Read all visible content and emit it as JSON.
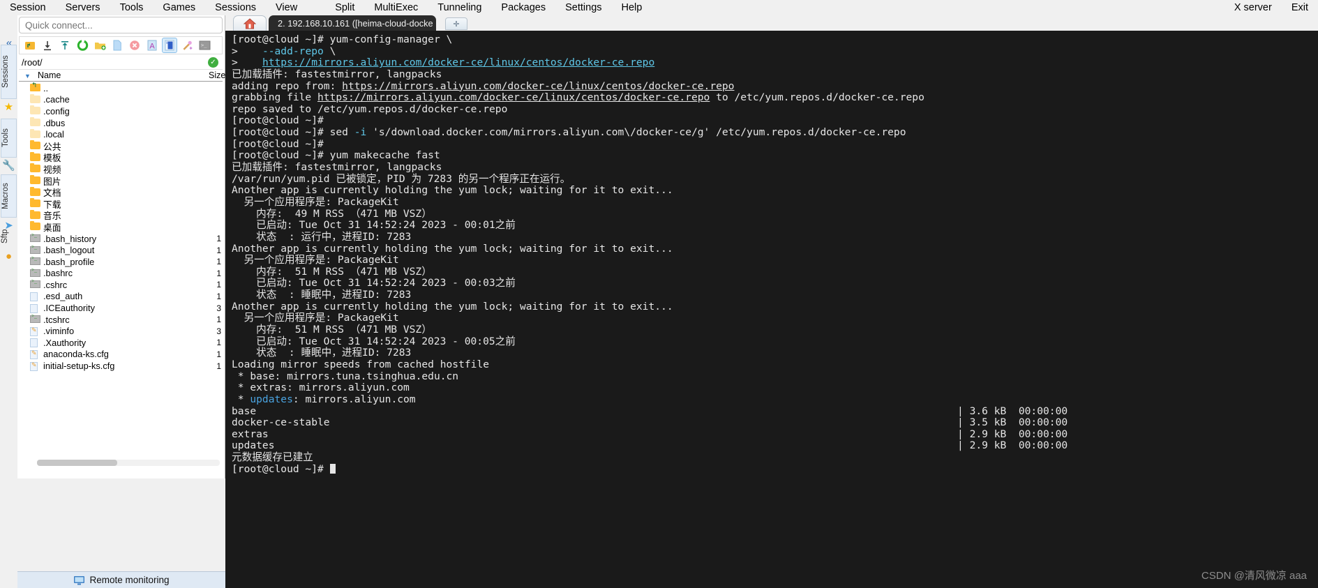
{
  "menubar": {
    "left_items": [
      "Session",
      "Servers",
      "Tools",
      "Games",
      "Sessions",
      "View"
    ],
    "right_group": [
      "Split",
      "MultiExec",
      "Tunneling",
      "Packages",
      "Settings",
      "Help"
    ],
    "far_right": [
      "X server",
      "Exit"
    ]
  },
  "sftp": {
    "quick_connect_placeholder": "Quick connect...",
    "toolbar_icons": [
      "upload-parent-icon",
      "download-icon",
      "upload-icon",
      "refresh-icon",
      "new-folder-icon",
      "new-file-icon",
      "delete-icon",
      "text-mode-icon",
      "follow-terminal-folder-icon",
      "permissions-icon",
      "open-terminal-icon"
    ],
    "path": "/root/",
    "path_status": "ok",
    "columns": {
      "name": "Name",
      "size": "Size"
    },
    "files": [
      {
        "name": "..",
        "size": "",
        "icon": "up"
      },
      {
        "name": ".cache",
        "size": "",
        "icon": "folder-lt"
      },
      {
        "name": ".config",
        "size": "",
        "icon": "folder-lt"
      },
      {
        "name": ".dbus",
        "size": "",
        "icon": "folder-lt"
      },
      {
        "name": ".local",
        "size": "",
        "icon": "folder-lt"
      },
      {
        "name": "公共",
        "size": "",
        "icon": "folder"
      },
      {
        "name": "模板",
        "size": "",
        "icon": "folder"
      },
      {
        "name": "视频",
        "size": "",
        "icon": "folder"
      },
      {
        "name": "图片",
        "size": "",
        "icon": "folder"
      },
      {
        "name": "文档",
        "size": "",
        "icon": "folder"
      },
      {
        "name": "下载",
        "size": "",
        "icon": "folder"
      },
      {
        "name": "音乐",
        "size": "",
        "icon": "folder"
      },
      {
        "name": "桌面",
        "size": "",
        "icon": "folder"
      },
      {
        "name": ".bash_history",
        "size": "1",
        "icon": "script"
      },
      {
        "name": ".bash_logout",
        "size": "1",
        "icon": "script"
      },
      {
        "name": ".bash_profile",
        "size": "1",
        "icon": "script"
      },
      {
        "name": ".bashrc",
        "size": "1",
        "icon": "script"
      },
      {
        "name": ".cshrc",
        "size": "1",
        "icon": "script"
      },
      {
        "name": ".esd_auth",
        "size": "1",
        "icon": "file"
      },
      {
        "name": ".ICEauthority",
        "size": "3",
        "icon": "file"
      },
      {
        "name": ".tcshrc",
        "size": "1",
        "icon": "script"
      },
      {
        "name": ".viminfo",
        "size": "3",
        "icon": "cfg"
      },
      {
        "name": ".Xauthority",
        "size": "1",
        "icon": "file"
      },
      {
        "name": "anaconda-ks.cfg",
        "size": "1",
        "icon": "cfg"
      },
      {
        "name": "initial-setup-ks.cfg",
        "size": "1",
        "icon": "cfg"
      }
    ],
    "status_bar": "Remote monitoring"
  },
  "rail": {
    "collapse_icon": "«",
    "tabs": [
      {
        "label": "Sessions",
        "icon": "star-icon"
      },
      {
        "label": "Tools",
        "icon": "wrench-icon"
      },
      {
        "label": "Macros",
        "icon": "paperplane-icon"
      },
      {
        "label": "Sftp",
        "icon": "dot-icon"
      }
    ]
  },
  "tabs": {
    "home_icon": "home-icon",
    "session_icon": "ssh-icon",
    "session_label": "2. 192.168.10.161 ([heima-cloud-docke",
    "close_label": "✕",
    "new_tab_label": "✛"
  },
  "terminal": {
    "lines": [
      {
        "segs": [
          {
            "t": "[root@cloud ~]# yum-config-manager \\"
          }
        ]
      },
      {
        "segs": [
          {
            "t": ">    "
          },
          {
            "t": "--add-repo",
            "c": "cy"
          },
          {
            "t": " \\"
          }
        ]
      },
      {
        "segs": [
          {
            "t": ">    "
          },
          {
            "t": "https://mirrors.aliyun.com/docker-ce/linux/centos/docker-ce.repo",
            "c": "cy-u"
          }
        ]
      },
      {
        "segs": [
          {
            "t": "已加载插件: fastestmirror, langpacks"
          }
        ]
      },
      {
        "segs": [
          {
            "t": "adding repo from: "
          },
          {
            "t": "https://mirrors.aliyun.com/docker-ce/linux/centos/docker-ce.repo",
            "c": "wh-u"
          }
        ]
      },
      {
        "segs": [
          {
            "t": "grabbing file "
          },
          {
            "t": "https://mirrors.aliyun.com/docker-ce/linux/centos/docker-ce.repo",
            "c": "wh-u"
          },
          {
            "t": " to /etc/yum.repos.d/docker-ce.repo"
          }
        ]
      },
      {
        "segs": [
          {
            "t": "repo saved to /etc/yum.repos.d/docker-ce.repo"
          }
        ]
      },
      {
        "segs": [
          {
            "t": "[root@cloud ~]#"
          }
        ]
      },
      {
        "segs": [
          {
            "t": "[root@cloud ~]# sed "
          },
          {
            "t": "-i",
            "c": "cy"
          },
          {
            "t": " 's/download.docker.com/mirrors.aliyun.com\\/docker-ce/g' /etc/yum.repos.d/docker-ce.repo"
          }
        ]
      },
      {
        "segs": [
          {
            "t": "[root@cloud ~]#"
          }
        ]
      },
      {
        "segs": [
          {
            "t": "[root@cloud ~]# yum makecache fast"
          }
        ]
      },
      {
        "segs": [
          {
            "t": "已加载插件: fastestmirror, langpacks"
          }
        ]
      },
      {
        "segs": [
          {
            "t": "/var/run/yum.pid 已被锁定，PID 为 7283 的另一个程序正在运行。"
          }
        ]
      },
      {
        "segs": [
          {
            "t": "Another app is currently holding the yum lock; waiting for it to exit..."
          }
        ]
      },
      {
        "segs": [
          {
            "t": "  另一个应用程序是: PackageKit"
          }
        ]
      },
      {
        "segs": [
          {
            "t": "    内存:  49 M RSS （471 MB VSZ）"
          }
        ]
      },
      {
        "segs": [
          {
            "t": "    已启动: Tue Oct 31 14:52:24 2023 - 00:01之前"
          }
        ]
      },
      {
        "segs": [
          {
            "t": "    状态  : 运行中，进程ID: 7283"
          }
        ]
      },
      {
        "segs": [
          {
            "t": "Another app is currently holding the yum lock; waiting for it to exit..."
          }
        ]
      },
      {
        "segs": [
          {
            "t": "  另一个应用程序是: PackageKit"
          }
        ]
      },
      {
        "segs": [
          {
            "t": "    内存:  51 M RSS （471 MB VSZ）"
          }
        ]
      },
      {
        "segs": [
          {
            "t": "    已启动: Tue Oct 31 14:52:24 2023 - 00:03之前"
          }
        ]
      },
      {
        "segs": [
          {
            "t": "    状态  : 睡眠中，进程ID: 7283"
          }
        ]
      },
      {
        "segs": [
          {
            "t": "Another app is currently holding the yum lock; waiting for it to exit..."
          }
        ]
      },
      {
        "segs": [
          {
            "t": "  另一个应用程序是: PackageKit"
          }
        ]
      },
      {
        "segs": [
          {
            "t": "    内存:  51 M RSS （471 MB VSZ）"
          }
        ]
      },
      {
        "segs": [
          {
            "t": "    已启动: Tue Oct 31 14:52:24 2023 - 00:05之前"
          }
        ]
      },
      {
        "segs": [
          {
            "t": "    状态  : 睡眠中，进程ID: 7283"
          }
        ]
      },
      {
        "segs": [
          {
            "t": "Loading mirror speeds from cached hostfile"
          }
        ]
      },
      {
        "segs": [
          {
            "t": " * base: mirrors.tuna.tsinghua.edu.cn"
          }
        ]
      },
      {
        "segs": [
          {
            "t": " * extras: mirrors.aliyun.com"
          }
        ]
      },
      {
        "segs": [
          {
            "t": " * "
          },
          {
            "t": "updates",
            "c": "blu"
          },
          {
            "t": ": mirrors.aliyun.com"
          }
        ]
      },
      {
        "segs": [
          {
            "t": "base"
          }
        ],
        "right": "| 3.6 kB  00:00:00"
      },
      {
        "segs": [
          {
            "t": "docker-ce-stable"
          }
        ],
        "right": "| 3.5 kB  00:00:00"
      },
      {
        "segs": [
          {
            "t": "extras"
          }
        ],
        "right": "| 2.9 kB  00:00:00"
      },
      {
        "segs": [
          {
            "t": "updates"
          }
        ],
        "right": "| 2.9 kB  00:00:00"
      },
      {
        "segs": [
          {
            "t": "元数据缓存已建立"
          }
        ]
      },
      {
        "segs": [
          {
            "t": "[root@cloud ~]# "
          }
        ],
        "cursor": true
      }
    ]
  },
  "watermark": "CSDN @清风微凉 aaa"
}
